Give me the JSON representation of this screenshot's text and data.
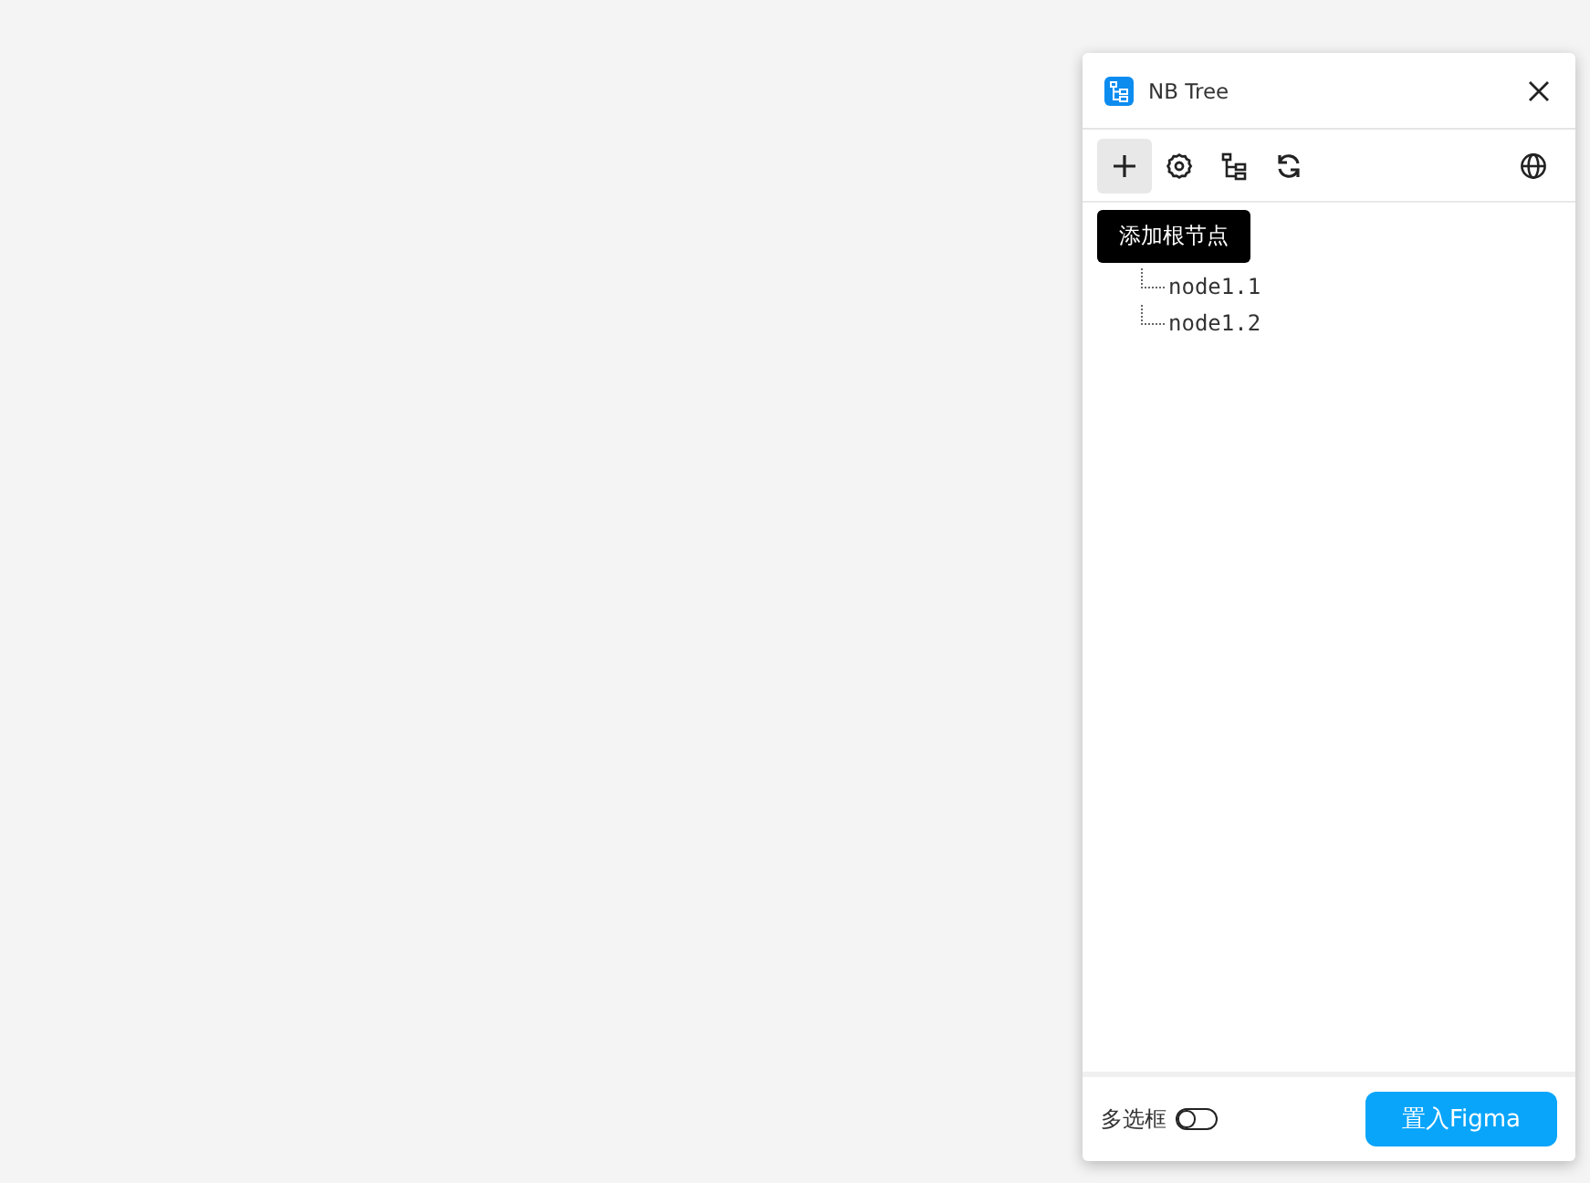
{
  "window": {
    "title": "NB Tree"
  },
  "toolbar": {
    "buttons": [
      {
        "kind": "add",
        "hovered": true
      },
      {
        "kind": "settings",
        "hovered": false
      },
      {
        "kind": "tree",
        "hovered": false
      },
      {
        "kind": "refresh",
        "hovered": false
      }
    ],
    "right": {
      "kind": "language"
    }
  },
  "tooltip": "添加根节点",
  "tree": {
    "nodes": [
      {
        "label": "node1.1"
      },
      {
        "label": "node1.2"
      }
    ]
  },
  "footer": {
    "toggle": {
      "label": "多选框",
      "on": false
    },
    "button": "置入Figma"
  }
}
